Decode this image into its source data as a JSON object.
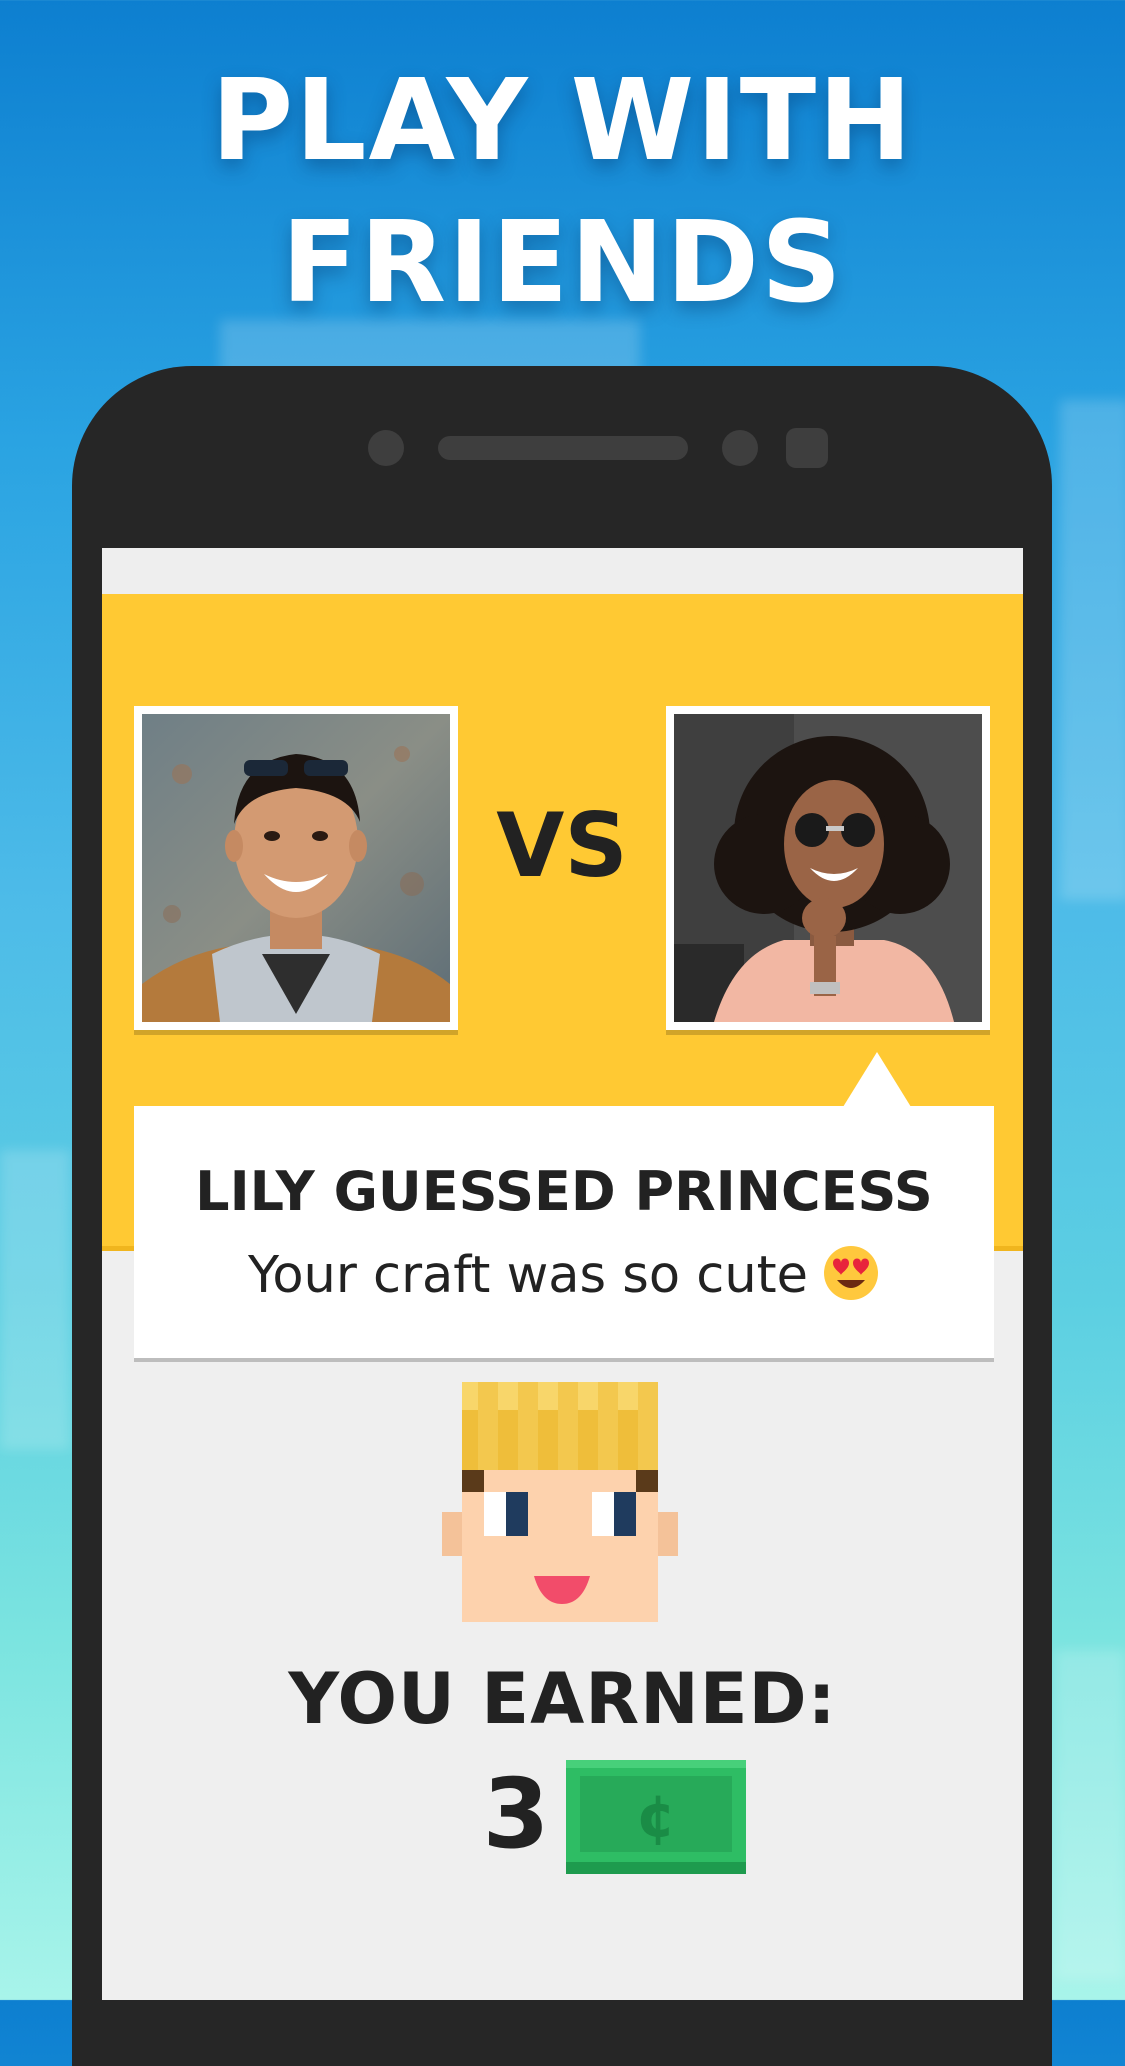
{
  "headline": {
    "line1": "PLAY WITH",
    "line2": "FRIENDS"
  },
  "match": {
    "player_left": "player-photo-boy",
    "versus_label": "VS",
    "player_right": "player-photo-girl"
  },
  "speech": {
    "title": "LILY GUESSED PRINCESS",
    "message": "Your craft was so cute",
    "emoji": "heart-eyes-emoji"
  },
  "reward": {
    "label": "YOU EARNED:",
    "amount": "3",
    "currency_icon": "cash-bill-icon"
  },
  "colors": {
    "panel": "#ffc933",
    "text": "#222222",
    "bill": "#2ebd64",
    "phone_body": "#262626"
  }
}
